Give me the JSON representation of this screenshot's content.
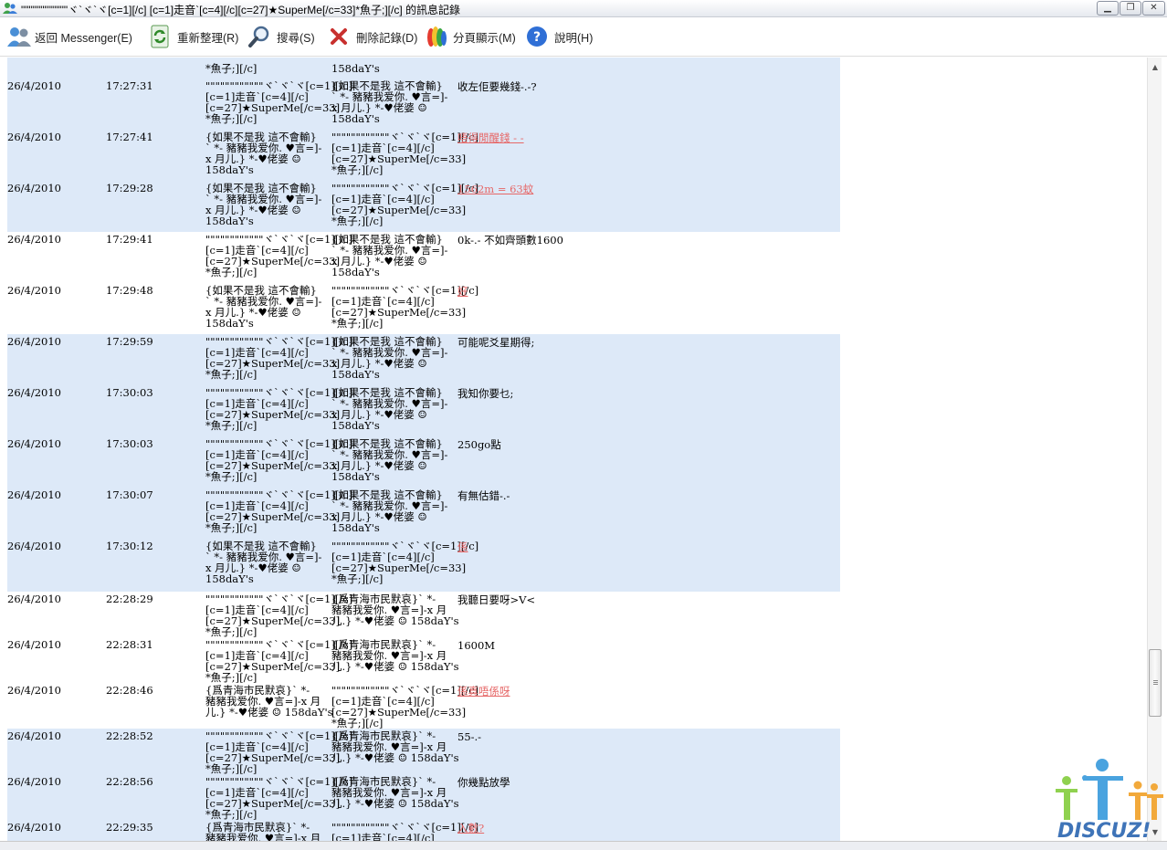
{
  "window": {
    "title": "\"\"\"\"\"\"\"\"\"\"\"\"ヾ`ヾ`ヾ[c=1][/c]                    [c=1]走音`[c=4][/c][c=27]★SuperMe[/c=33]*魚子;][/c] 的訊息記錄",
    "minimize_label": "▁",
    "restore_label": "❐",
    "close_label": "✕"
  },
  "toolbar": {
    "back": "返回 Messenger(E)",
    "refresh": "重新整理(R)",
    "search": "搜尋(S)",
    "delete": "刪除記錄(D)",
    "paging": "分頁顯示(M)",
    "help": "說明(H)"
  },
  "colors": {
    "row_highlight": "#dde9f8",
    "link_message": "#e66868"
  },
  "names": {
    "self_short": "\"\"\"\"\"\"\"\"\"\"\"\"ヾ`ヾ`ヾ[c=1][/c]\n[c=1]走音`[c=4][/c]\n[c=27]★SuperMe[/c=33]\n*魚子;][/c]",
    "friend_a": "{如果不是我 這不會輸}\n` *- 豬豬我爱你. ♥言=]-\nx 月儿.} *-♥佬婆 ☺\n158daY's",
    "friend_b": "{爲青海市民默哀}` *-\n豬豬我爱你. ♥言=]-x 月\n儿.} *-♥佬婆 ☺ 158daY's",
    "self_cut": "*魚子;][/c]",
    "friend_cut": "158daY's",
    "self_head": "\"\"\"\"\"\"\"\"\"\"\"\"ヾ`ヾ`ヾ[c=1][/c]\n[c=1]走音`[c=4][/c]",
    "friend_b_head": "{爲青海市民默哀}` *-\n豬豬我爱你. ♥言=]-x 月"
  },
  "messages": [
    {
      "date": "26/4/2010",
      "time": "17:27:31",
      "text": "收左佢要幾錢-.-?",
      "linked": false
    },
    {
      "date": "26/4/2010",
      "time": "17:27:41",
      "text": "唔得閒醒錢 - -",
      "linked": true
    },
    {
      "date": "26/4/2010",
      "time": "17:29:28",
      "text": "1562m = 63蚊",
      "linked": true
    },
    {
      "date": "26/4/2010",
      "time": "17:29:41",
      "text": "0k-.- 不如齊頭數1600",
      "linked": false
    },
    {
      "date": "26/4/2010",
      "time": "17:29:48",
      "text": "好",
      "linked": true
    },
    {
      "date": "26/4/2010",
      "time": "17:29:59",
      "text": "可能呢爻星期得;",
      "linked": false
    },
    {
      "date": "26/4/2010",
      "time": "17:30:03",
      "text": "我知你要乜;",
      "linked": false
    },
    {
      "date": "26/4/2010",
      "time": "17:30:03",
      "text": "250go點",
      "linked": false
    },
    {
      "date": "26/4/2010",
      "time": "17:30:07",
      "text": "有無估錯-.-",
      "linked": false
    },
    {
      "date": "26/4/2010",
      "time": "17:30:12",
      "text": "係",
      "linked": true
    },
    {
      "date": "26/4/2010",
      "time": "22:28:29",
      "text": "我聽日要呀>V<",
      "linked": false
    },
    {
      "date": "26/4/2010",
      "time": "22:28:31",
      "text": "1600M",
      "linked": false
    },
    {
      "date": "26/4/2010",
      "time": "22:28:46",
      "text": "係真唔係呀",
      "linked": true
    },
    {
      "date": "26/4/2010",
      "time": "22:28:52",
      "text": "55-.-",
      "linked": false
    },
    {
      "date": "26/4/2010",
      "time": "22:28:56",
      "text": "你幾點放學",
      "linked": false
    },
    {
      "date": "26/4/2010",
      "time": "22:29:35",
      "text": "入數?",
      "linked": true
    }
  ],
  "watermark": {
    "text": "DISCUZ!"
  }
}
